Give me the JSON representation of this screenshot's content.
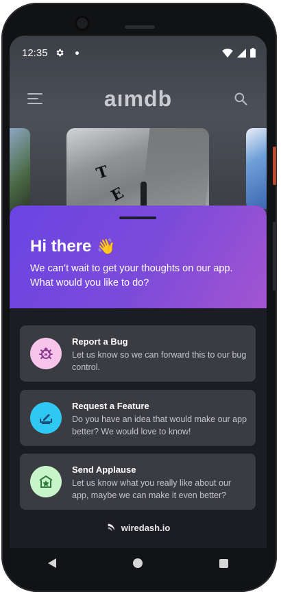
{
  "status_bar": {
    "time": "12:35",
    "icons": [
      "gear-icon",
      "notification-dot-icon",
      "wifi-icon",
      "signal-icon",
      "battery-icon"
    ]
  },
  "app_bar": {
    "logo": "aımdb",
    "menu_icon": "menu-icon",
    "search_icon": "search-icon"
  },
  "poster": {
    "letters": [
      "T",
      "E"
    ]
  },
  "sheet": {
    "greeting": "Hi there",
    "greeting_emoji": "👋",
    "subtitle": "We can’t wait to get your thoughts on our app. What would you like to do?",
    "options": [
      {
        "title": "Report a Bug",
        "description": "Let us know so we can forward this to our bug control.",
        "icon": "bug-icon",
        "icon_bg": "#f7c5ec",
        "icon_color": "#8a3a8f"
      },
      {
        "title": "Request a Feature",
        "description": "Do you have an idea that would make our app better? We would love to know!",
        "icon": "feature-request-icon",
        "icon_bg": "#2fc8f2",
        "icon_color": "#1c4c7a"
      },
      {
        "title": "Send Applause",
        "description": "Let us know what you really like about our app, maybe we can make it even better?",
        "icon": "applause-icon",
        "icon_bg": "#c7f5c9",
        "icon_color": "#2e7c3c"
      }
    ],
    "brand": "wiredash.io"
  },
  "colors": {
    "header_start": "#6a44e3",
    "header_end": "#a355d1",
    "card_bg": "#3b3c42",
    "sheet_bg": "#1c1d24"
  },
  "nav_bar": {
    "icons": [
      "back-icon",
      "home-icon",
      "recent-apps-icon"
    ]
  }
}
